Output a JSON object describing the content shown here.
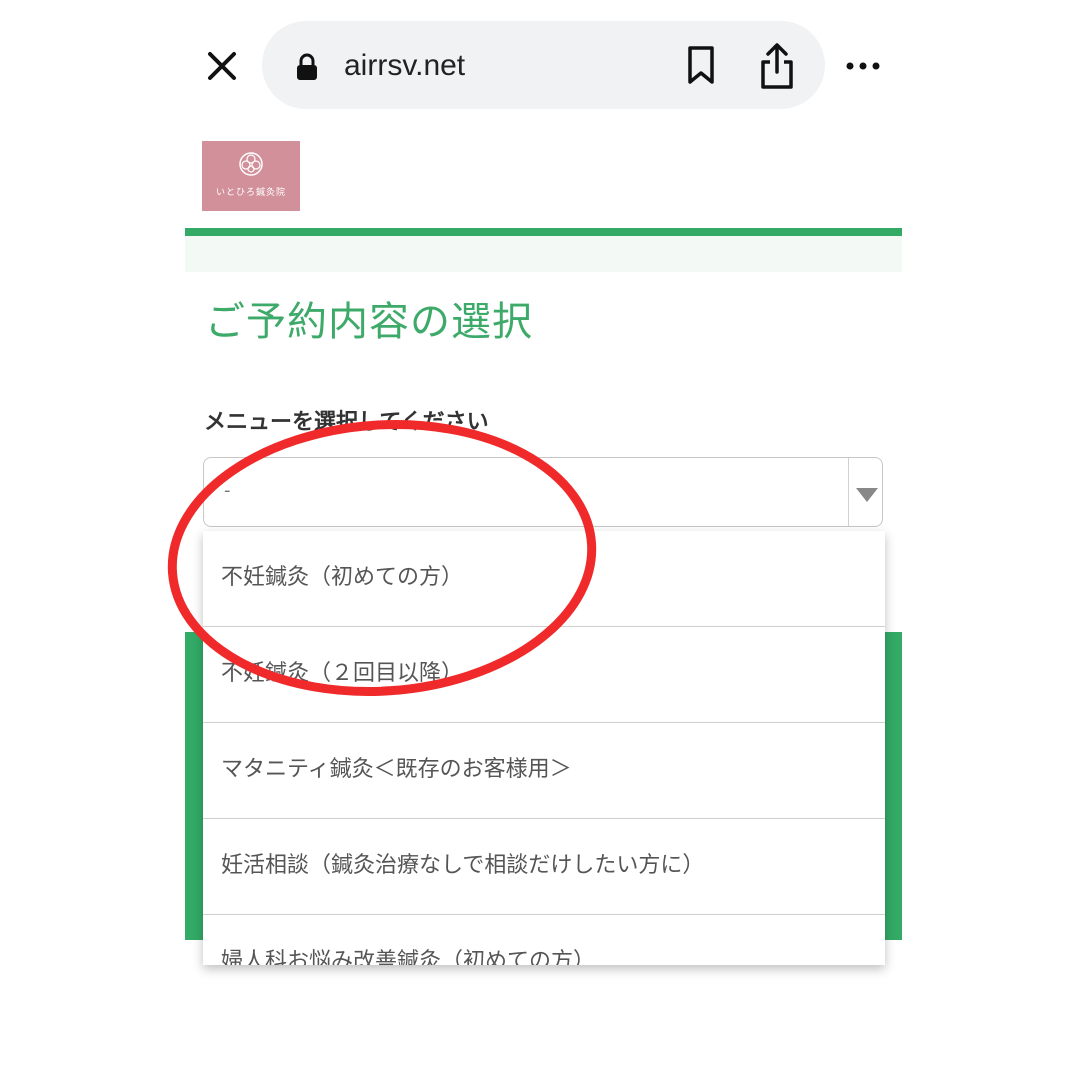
{
  "browser": {
    "url": "airrsv.net"
  },
  "logo": {
    "text": "いとひろ鍼灸院"
  },
  "page": {
    "title": "ご予約内容の選択",
    "menu_label": "メニューを選択してください"
  },
  "select": {
    "value": "-"
  },
  "dropdown": {
    "options": [
      "不妊鍼灸（初めての方）",
      "不妊鍼灸（２回目以降）",
      "マタニティ鍼灸＜既存のお客様用＞",
      "妊活相談（鍼灸治療なしで相談だけしたい方に）",
      "婦人科お悩み改善鍼灸（初めての方）"
    ]
  },
  "colors": {
    "accent_green": "#33aa66",
    "title_green": "#3daa6a",
    "logo_pink": "#d2909b",
    "annotation_red": "#f02a2a"
  }
}
